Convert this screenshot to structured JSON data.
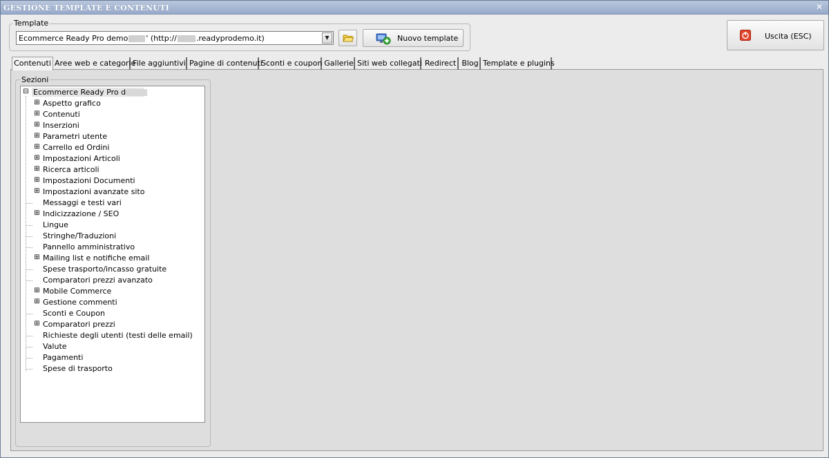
{
  "window": {
    "title": "GESTIONE TEMPLATE E CONTENUTI"
  },
  "template_group": {
    "legend": "Template",
    "combo_text_1": "Ecommerce Ready Pro demo",
    "combo_text_2": "' (http://",
    "combo_text_3": ".readyprodemo.it)",
    "new_template_label": "Nuovo template"
  },
  "exit_button": {
    "label": "Uscita (ESC)"
  },
  "tabs": [
    "Contenuti",
    "Aree web e categorie",
    "File aggiuntivi",
    "Pagine di contenuti",
    "Sconti e coupon",
    "Gallerie",
    "Siti web collegati",
    "Redirect",
    "Blog",
    "Template e plugins"
  ],
  "sections": {
    "legend": "Sezioni",
    "root": "Ecommerce Ready Pro demo",
    "items": [
      {
        "label": "Aspetto grafico",
        "expandable": true
      },
      {
        "label": "Contenuti",
        "expandable": true
      },
      {
        "label": "Inserzioni",
        "expandable": true
      },
      {
        "label": "Parametri utente",
        "expandable": true
      },
      {
        "label": "Carrello ed Ordini",
        "expandable": true
      },
      {
        "label": "Impostazioni Articoli",
        "expandable": true
      },
      {
        "label": "Ricerca articoli",
        "expandable": true
      },
      {
        "label": "Impostazioni Documenti",
        "expandable": true
      },
      {
        "label": "Impostazioni avanzate sito",
        "expandable": true
      },
      {
        "label": "Messaggi e testi vari",
        "expandable": false
      },
      {
        "label": "Indicizzazione / SEO",
        "expandable": true
      },
      {
        "label": "Lingue",
        "expandable": false
      },
      {
        "label": "Stringhe/Traduzioni",
        "expandable": false
      },
      {
        "label": "Pannello amministrativo",
        "expandable": false
      },
      {
        "label": "Mailing list e notifiche email",
        "expandable": true
      },
      {
        "label": "Spese trasporto/incasso gratuite",
        "expandable": false
      },
      {
        "label": "Comparatori prezzi avanzato",
        "expandable": false
      },
      {
        "label": "Mobile Commerce",
        "expandable": true
      },
      {
        "label": "Gestione commenti",
        "expandable": true
      },
      {
        "label": "Sconti e Coupon",
        "expandable": false
      },
      {
        "label": "Comparatori prezzi",
        "expandable": true
      },
      {
        "label": "Richieste degli utenti (testi delle email)",
        "expandable": false
      },
      {
        "label": "Valute",
        "expandable": false
      },
      {
        "label": "Pagamenti",
        "expandable": false
      },
      {
        "label": "Spese di trasporto",
        "expandable": false
      }
    ]
  },
  "colors": {
    "title_bar": "#98abcb",
    "window_bg": "#ececec",
    "tree_bg": "#ffffff"
  }
}
